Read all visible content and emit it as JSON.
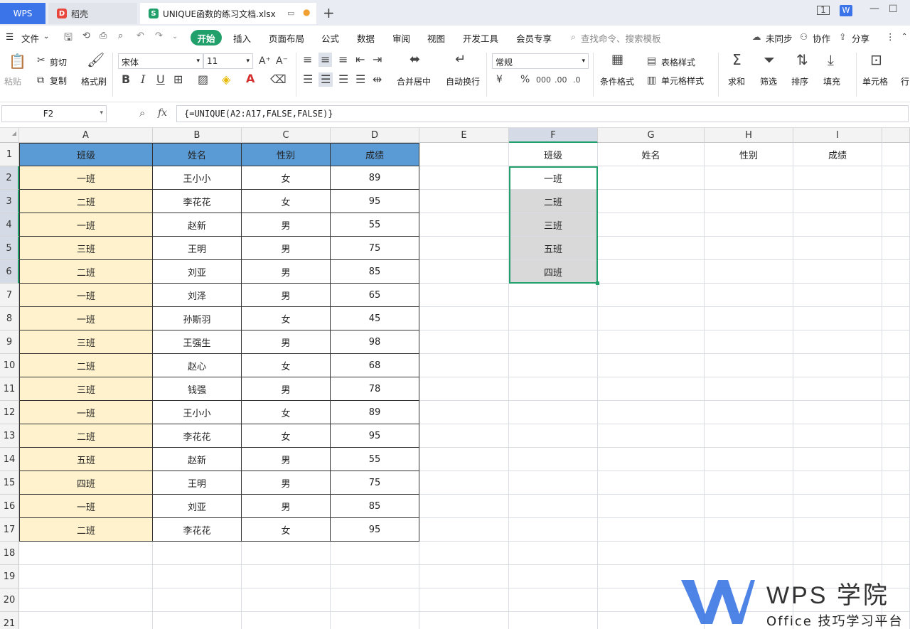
{
  "tabs": {
    "wps": "WPS",
    "tab1": "稻壳",
    "tab2": "UNIQUE函数的练习文档.xlsx"
  },
  "menu": {
    "file": "文件",
    "start": "开始",
    "items": [
      "插入",
      "页面布局",
      "公式",
      "数据",
      "审阅",
      "视图",
      "开发工具",
      "会员专享"
    ],
    "search": "查找命令、搜索模板",
    "unsync": "未同步",
    "collab": "协作",
    "share": "分享"
  },
  "ribbon": {
    "paste": "粘贴",
    "cut": "剪切",
    "copy": "复制",
    "format_painter": "格式刷",
    "font_name": "宋体",
    "font_size": "11",
    "merge": "合并居中",
    "wrap": "自动换行",
    "number_format": "常规",
    "cond_format": "条件格式",
    "table_style": "表格样式",
    "cell_style": "单元格样式",
    "sum": "求和",
    "filter": "筛选",
    "sort": "排序",
    "fill": "填充",
    "cell": "单元格",
    "row_col": "行"
  },
  "formula_bar": {
    "name_box": "F2",
    "fx": "fx",
    "formula": "{=UNIQUE(A2:A17,FALSE,FALSE)}"
  },
  "columns": [
    "A",
    "B",
    "C",
    "D",
    "E",
    "F",
    "G",
    "H",
    "I"
  ],
  "rows": [
    "1",
    "2",
    "3",
    "4",
    "5",
    "6",
    "7",
    "8",
    "9",
    "10",
    "11",
    "12",
    "13",
    "14",
    "15",
    "16",
    "17",
    "18",
    "19",
    "20",
    "21"
  ],
  "table": {
    "headers": [
      "班级",
      "姓名",
      "性别",
      "成绩"
    ],
    "rows": [
      [
        "一班",
        "王小小",
        "女",
        "89"
      ],
      [
        "二班",
        "李花花",
        "女",
        "95"
      ],
      [
        "一班",
        "赵新",
        "男",
        "55"
      ],
      [
        "三班",
        "王明",
        "男",
        "75"
      ],
      [
        "二班",
        "刘亚",
        "男",
        "85"
      ],
      [
        "一班",
        "刘泽",
        "男",
        "65"
      ],
      [
        "一班",
        "孙斯羽",
        "女",
        "45"
      ],
      [
        "三班",
        "王强生",
        "男",
        "98"
      ],
      [
        "二班",
        "赵心",
        "女",
        "68"
      ],
      [
        "三班",
        "钱强",
        "男",
        "78"
      ],
      [
        "一班",
        "王小小",
        "女",
        "89"
      ],
      [
        "二班",
        "李花花",
        "女",
        "95"
      ],
      [
        "五班",
        "赵新",
        "男",
        "55"
      ],
      [
        "四班",
        "王明",
        "男",
        "75"
      ],
      [
        "一班",
        "刘亚",
        "男",
        "85"
      ],
      [
        "二班",
        "李花花",
        "女",
        "95"
      ]
    ]
  },
  "result": {
    "headers": [
      "班级",
      "姓名",
      "性别",
      "成绩"
    ],
    "unique_values": [
      "一班",
      "二班",
      "三班",
      "五班",
      "四班"
    ]
  },
  "watermark": {
    "brand": "WPS 学院",
    "tagline": "Office 技巧学习平台"
  },
  "colors": {
    "accent_green": "#22a06b",
    "header_blue": "#5b9bd5",
    "class_fill": "#fff2cc",
    "spill_fill": "#d9d9d9",
    "wps_tab": "#3b74e8"
  }
}
